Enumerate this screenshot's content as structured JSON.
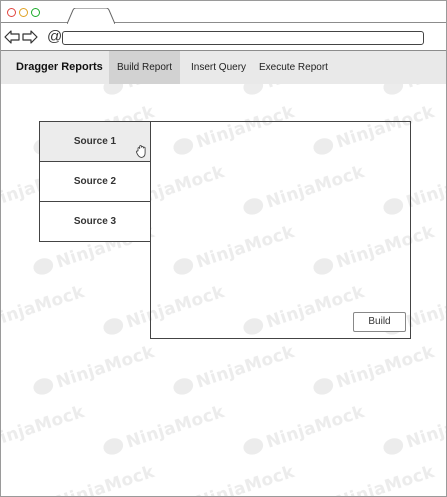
{
  "browser": {
    "window_controls": [
      "close",
      "minimize",
      "maximize"
    ],
    "tab_title": "",
    "address_value": ""
  },
  "app": {
    "brand": "Dragger Reports",
    "nav": [
      {
        "label": "Build Report",
        "active": true
      },
      {
        "label": "Insert Query",
        "active": false
      },
      {
        "label": "Execute Report",
        "active": false
      }
    ]
  },
  "sources": [
    {
      "label": "Source 1",
      "selected": true
    },
    {
      "label": "Source 2",
      "selected": false
    },
    {
      "label": "Source 3",
      "selected": false
    }
  ],
  "canvas": {
    "build_label": "Build"
  },
  "watermark_text": "NinjaMock",
  "icons": {
    "back": "back-arrow-icon",
    "forward": "forward-arrow-icon",
    "at": "at-icon",
    "drag": "drag-hand-icon"
  },
  "colors": {
    "close": "#e0443e",
    "minimize": "#dea123",
    "maximize": "#1aab29",
    "nav_bg": "#e9e9e9",
    "nav_active": "#d2d2d2"
  }
}
